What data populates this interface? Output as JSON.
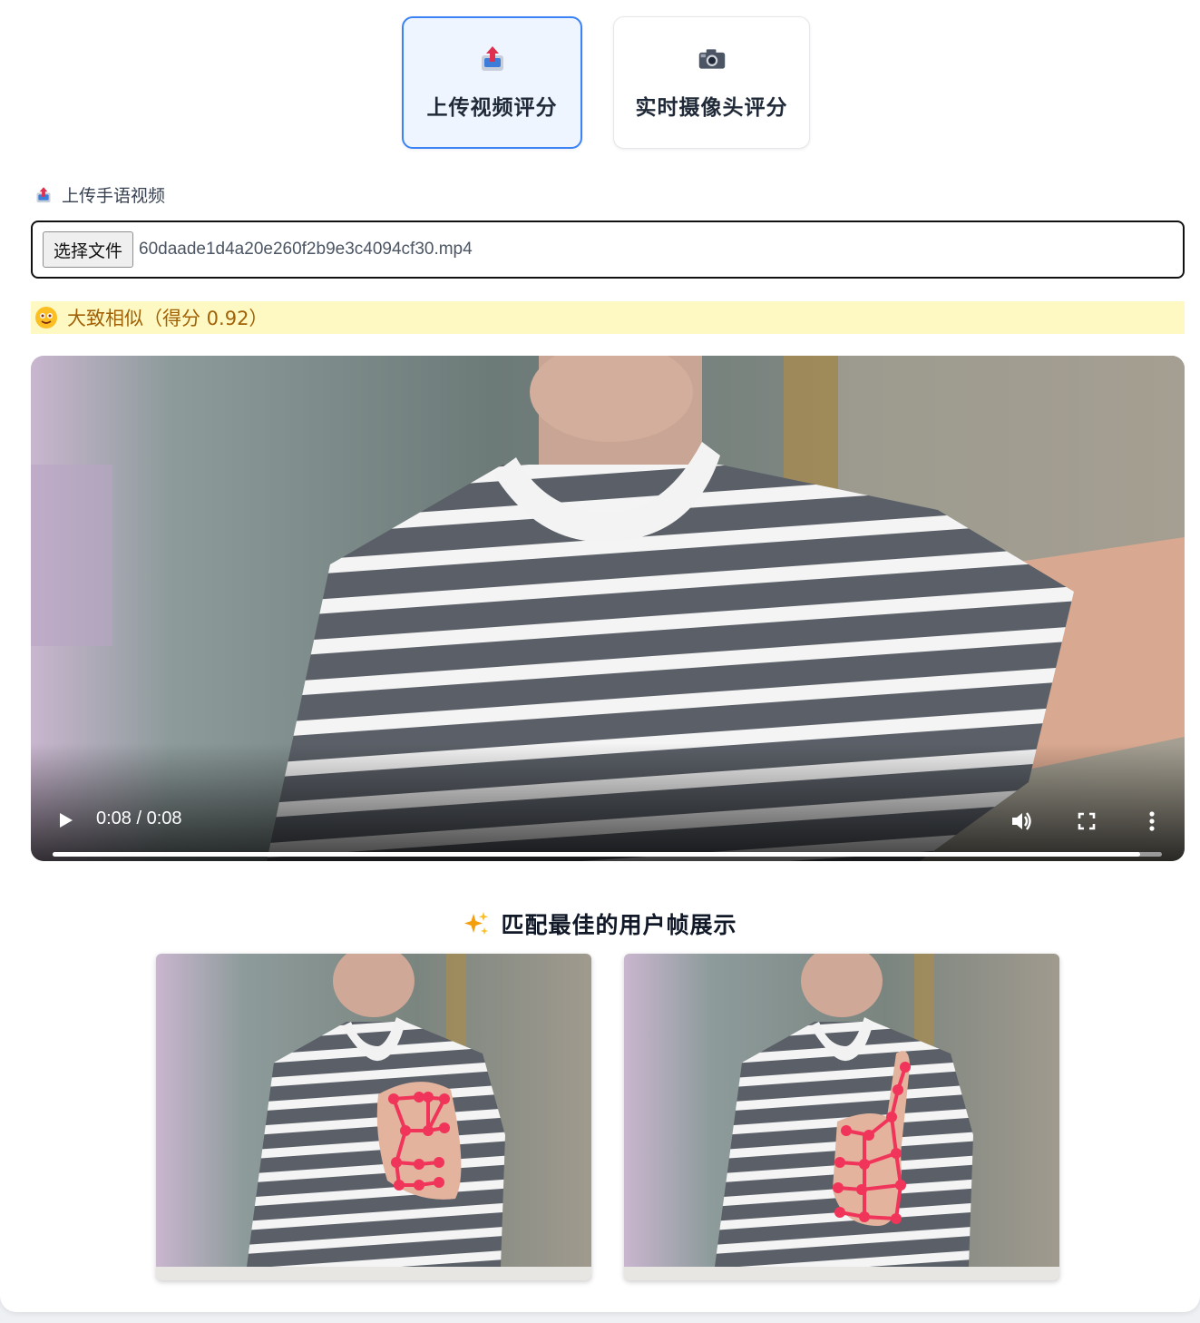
{
  "modes": [
    {
      "label": "上传视频评分",
      "icon": "upload-tray-icon",
      "active": true
    },
    {
      "label": "实时摄像头评分",
      "icon": "camera-icon",
      "active": false
    }
  ],
  "upload": {
    "section_label": "上传手语视频",
    "icon": "upload-tray-icon",
    "choose_button": "选择文件",
    "file_name": "60daade1d4a20e260f2b9e3c4094cf30.mp4"
  },
  "result": {
    "icon": "slightly-smiling-face-icon",
    "text": "大致相似（得分 0.92）"
  },
  "video": {
    "time": "0:08 / 0:08",
    "progress": 0.98,
    "icons": [
      "play-icon",
      "volume-icon",
      "fullscreen-icon",
      "more-options-icon"
    ]
  },
  "best_frames": {
    "icon": "sparkles-icon",
    "title": "匹配最佳的用户帧展示",
    "count": 2
  },
  "colors": {
    "accent": "#3b82f6",
    "result_bg": "#fef9c3",
    "result_text": "#a16207",
    "hand_landmarks": "#f0345a"
  }
}
